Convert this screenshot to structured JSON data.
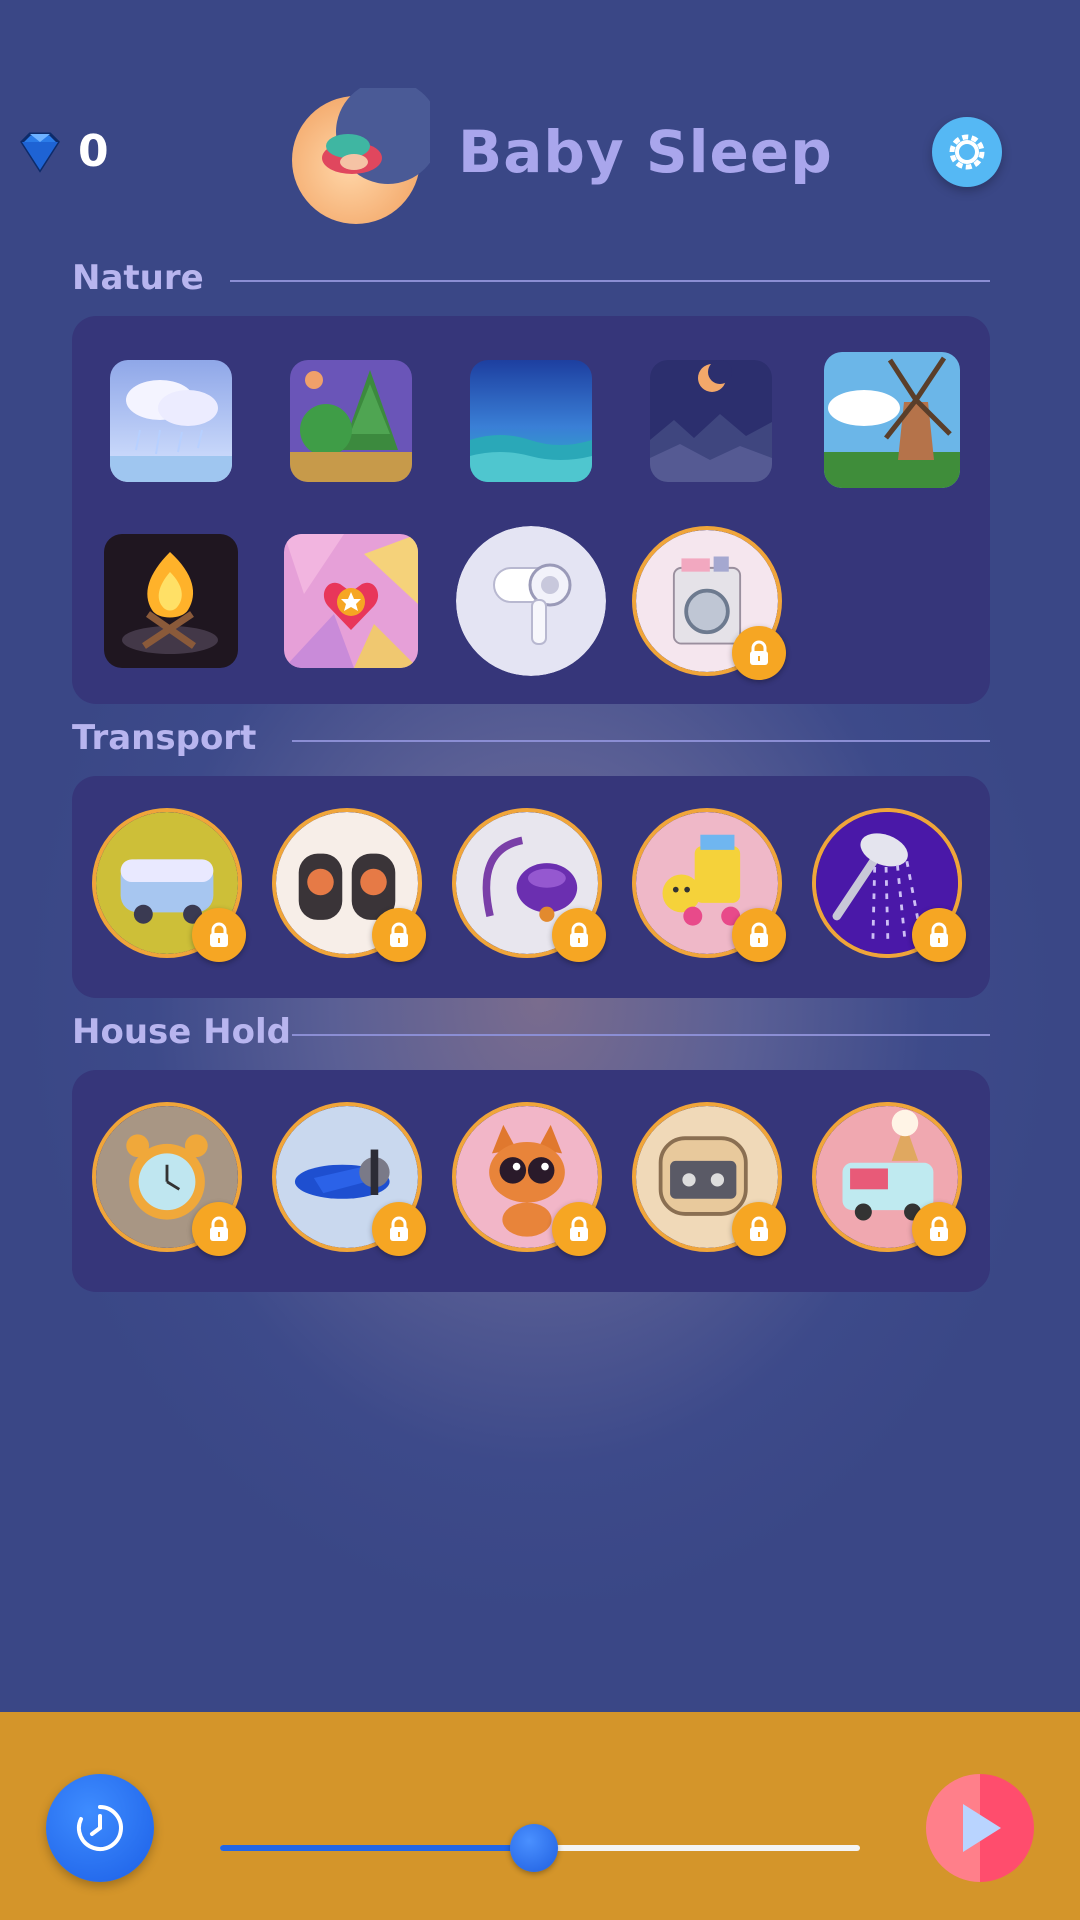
{
  "header": {
    "gem_count": "0",
    "app_title": "Baby Sleep"
  },
  "sections": [
    {
      "title": "Nature",
      "items": [
        {
          "icon": "rain-cloud-icon",
          "locked": false
        },
        {
          "icon": "forest-icon",
          "locked": false
        },
        {
          "icon": "ocean-icon",
          "locked": false
        },
        {
          "icon": "night-moon-icon",
          "locked": false
        },
        {
          "icon": "windmill-icon",
          "locked": false
        },
        {
          "icon": "campfire-icon",
          "locked": false
        },
        {
          "icon": "heart-pattern-icon",
          "locked": false
        },
        {
          "icon": "hair-dryer-icon",
          "locked": false
        },
        {
          "icon": "washing-machine-icon",
          "locked": true
        }
      ]
    },
    {
      "title": "Transport",
      "items": [
        {
          "icon": "van-icon",
          "locked": true
        },
        {
          "icon": "fan-icon",
          "locked": true
        },
        {
          "icon": "vacuum-icon",
          "locked": true
        },
        {
          "icon": "toy-train-icon",
          "locked": true
        },
        {
          "icon": "shower-icon",
          "locked": true
        }
      ]
    },
    {
      "title": "House Hold",
      "items": [
        {
          "icon": "alarm-clock-icon",
          "locked": true
        },
        {
          "icon": "airplane-icon",
          "locked": true
        },
        {
          "icon": "cat-icon",
          "locked": true
        },
        {
          "icon": "cassette-icon",
          "locked": true
        },
        {
          "icon": "ice-cream-truck-icon",
          "locked": true
        }
      ]
    }
  ],
  "player": {
    "volume": 0.49
  },
  "colors": {
    "accent_orange": "#d4952a",
    "panel": "#36367a",
    "lock": "#f6a623",
    "settings": "#55b8f4"
  }
}
